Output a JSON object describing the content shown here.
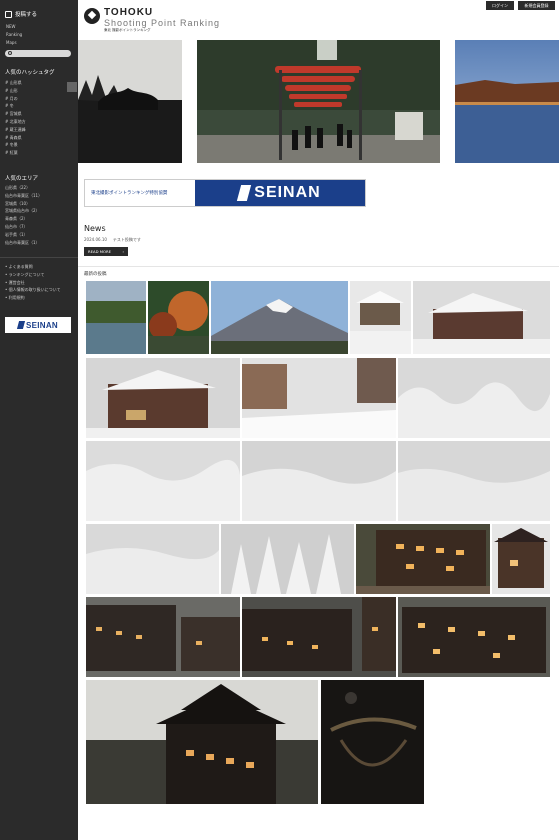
{
  "header": {
    "logo_title": "TOHOKU",
    "logo_subtitle": "Shooting Point Ranking",
    "logo_caption": "東北 撮影ポイントランキング",
    "login_label": "ログイン",
    "signup_label": "新規会員登録"
  },
  "sidebar": {
    "post_label": "投稿する",
    "nav": [
      "NEW",
      "Ranking",
      "Maps"
    ],
    "hashtags_title": "人気のハッシュタグ",
    "hashtags": [
      "# 山形県",
      "# 山形",
      "# 月の",
      "# 冬",
      "# 宮城県",
      "# 北東地方",
      "# 蔵王連峰",
      "# 青森県",
      "# 冬景",
      "# 紅葉"
    ],
    "areas_title": "人気のエリア",
    "areas": [
      "山形県（22）",
      "仙台市青葉区（11）",
      "宮城県（10）",
      "宮城県仙台市（2）",
      "青森県（2）",
      "仙台市（7）",
      "岩手県（1）",
      "仙台市青葉区（1）"
    ],
    "links": [
      "よくある質問",
      "ランキングについて",
      "運営会社",
      "個人情報の取り扱いについて",
      "利用規約"
    ],
    "sponsor_name": "SEINAN"
  },
  "banner": {
    "left_text": "東北撮影ポイントランキング特別協賛",
    "brand": "SEINAN"
  },
  "news": {
    "title": "News",
    "date": "2024.06.10",
    "item_text": "テスト投稿です",
    "read_more_label": "READ MORE"
  },
  "latest": {
    "title": "最新の投稿"
  },
  "colors": {
    "sidebar_bg": "#2b2b2b",
    "brand_blue": "#1b3f8a",
    "accent_red": "#c0392b"
  }
}
